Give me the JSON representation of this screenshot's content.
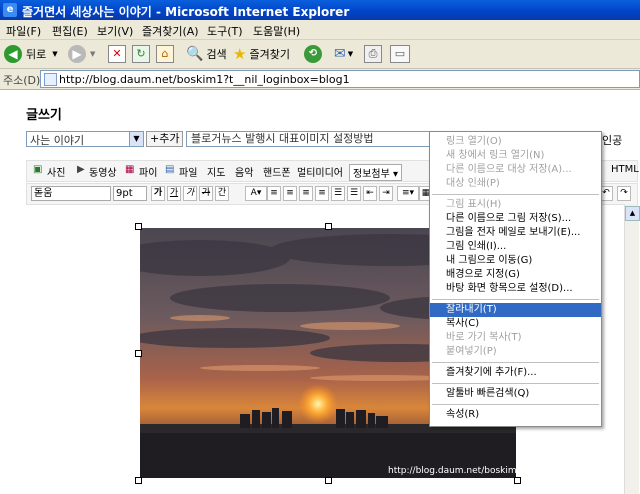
{
  "window": {
    "title": "즐거면서 세상사는 이야기 - Microsoft Internet Explorer"
  },
  "menubar": [
    "파일(F)",
    "편집(E)",
    "보기(V)",
    "즐겨찾기(A)",
    "도구(T)",
    "도움말(H)"
  ],
  "toolbar": {
    "back": "뒤로",
    "search": "검색",
    "favorites": "즐겨찾기"
  },
  "address": {
    "label": "주소(D)",
    "url": "http://blog.daum.net/boskim1?t__nil_loginbox=blog1"
  },
  "editor": {
    "heading": "글쓰기",
    "category": "사는 이야기",
    "add_category": "+추가",
    "post_title": "블로거뉴스 발행시 대표이미지 설정방법",
    "peek_right": "인공",
    "toolbar1": [
      "사진",
      "동영상",
      "파이",
      "파일",
      "지도",
      "음악",
      "핸드폰",
      "멀티미디어",
      "정보첨부 ▾"
    ],
    "html_label": "HTML",
    "font": "돋움",
    "size": "9pt",
    "toolbar2_buttons": [
      "가",
      "가",
      "가",
      "가",
      "간"
    ]
  },
  "photo": {
    "watermark": "http://blog.daum.net/boskim1"
  },
  "context_menu": [
    {
      "label": "링크 열기(O)",
      "disabled": true
    },
    {
      "label": "새 창에서 링크 열기(N)",
      "disabled": true
    },
    {
      "label": "다른 이름으로 대상 저장(A)...",
      "disabled": true
    },
    {
      "label": "대상 인쇄(P)",
      "disabled": true
    },
    {
      "separator": true
    },
    {
      "label": "그림 표시(H)",
      "disabled": true
    },
    {
      "label": "다른 이름으로 그림 저장(S)...",
      "disabled": false
    },
    {
      "label": "그림을 전자 메일로 보내기(E)...",
      "disabled": false
    },
    {
      "label": "그림 인쇄(I)...",
      "disabled": false
    },
    {
      "label": "내 그림으로 이동(G)",
      "disabled": false
    },
    {
      "label": "배경으로 지정(G)",
      "disabled": false
    },
    {
      "label": "바탕 화면 항목으로 설정(D)...",
      "disabled": false
    },
    {
      "separator": true
    },
    {
      "label": "잘라내기(T)",
      "disabled": false,
      "selected": true
    },
    {
      "label": "복사(C)",
      "disabled": false
    },
    {
      "label": "바로 가기 복사(T)",
      "disabled": true
    },
    {
      "label": "붙여넣기(P)",
      "disabled": true
    },
    {
      "separator": true
    },
    {
      "label": "즐겨찾기에 추가(F)...",
      "disabled": false
    },
    {
      "separator": true
    },
    {
      "label": "알툴바 빠른검색(Q)",
      "disabled": false
    },
    {
      "separator": true
    },
    {
      "label": "속성(R)",
      "disabled": false
    }
  ],
  "colors": {
    "titlebar": "#0a5fdc",
    "menu_highlight": "#316ac5"
  }
}
